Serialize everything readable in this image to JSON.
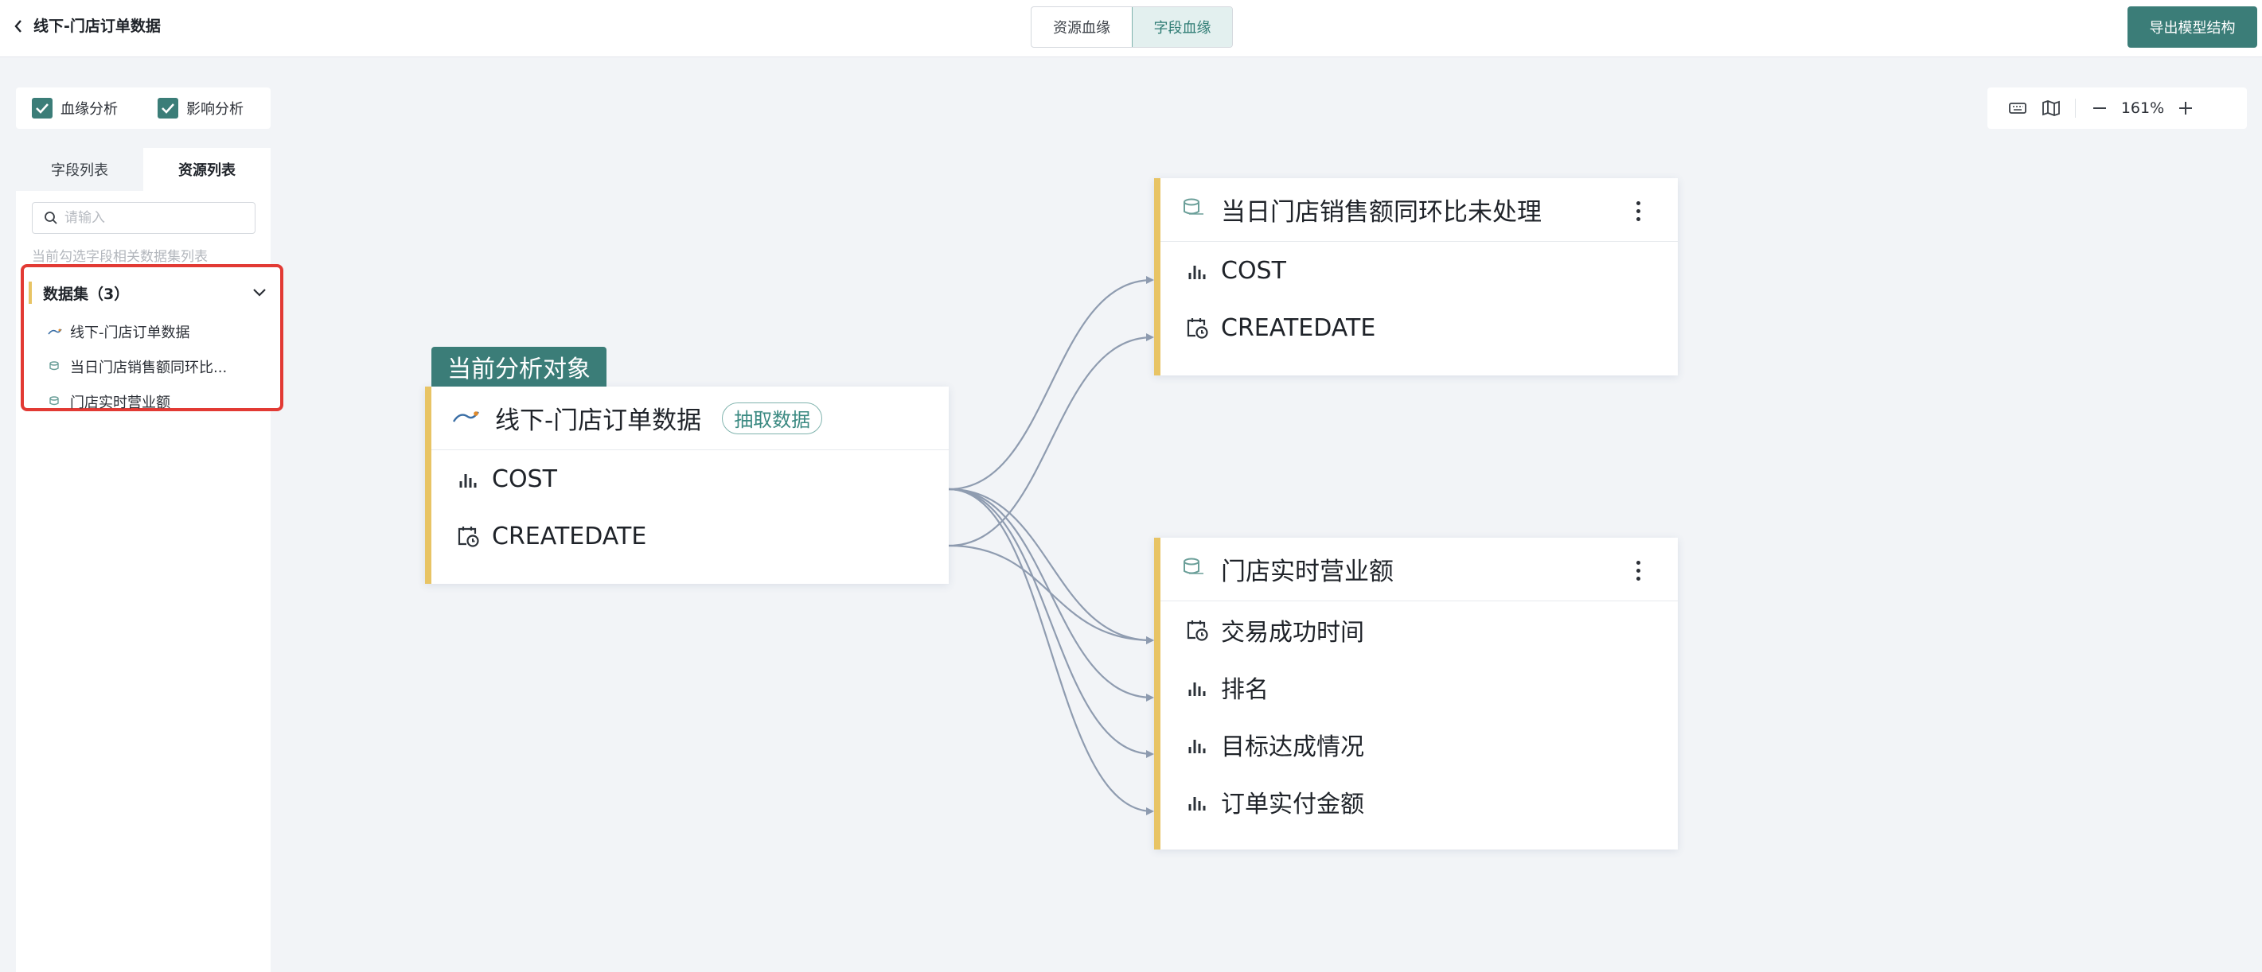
{
  "header": {
    "title": "线下-门店订单数据",
    "tabs": [
      {
        "label": "资源血缘",
        "active": false
      },
      {
        "label": "字段血缘",
        "active": true
      }
    ],
    "export_label": "导出模型结构"
  },
  "toggles": [
    {
      "label": "血缘分析",
      "checked": true
    },
    {
      "label": "影响分析",
      "checked": true
    }
  ],
  "zoom": {
    "value": "161%"
  },
  "sidebar": {
    "tabs": [
      {
        "label": "字段列表",
        "active": false
      },
      {
        "label": "资源列表",
        "active": true
      }
    ],
    "search_placeholder": "请输入",
    "hint": "当前勾选字段相关数据集列表",
    "group_title": "数据集（3）",
    "items": [
      {
        "label": "线下-门店订单数据",
        "icon": "mysql-icon"
      },
      {
        "label": "当日门店销售额同环比...",
        "icon": "etl-icon"
      },
      {
        "label": "门店实时营业额",
        "icon": "etl-icon"
      }
    ]
  },
  "canvas": {
    "current_tag": "当前分析对象",
    "source": {
      "title": "线下-门店订单数据",
      "badge": "抽取数据",
      "icon": "mysql-icon",
      "fields": [
        {
          "name": "COST",
          "type": "measure"
        },
        {
          "name": "CREATEDATE",
          "type": "date"
        }
      ]
    },
    "targets": [
      {
        "title": "当日门店销售额同环比未处理",
        "icon": "etl-icon",
        "fields": [
          {
            "name": "COST",
            "type": "measure"
          },
          {
            "name": "CREATEDATE",
            "type": "date"
          }
        ]
      },
      {
        "title": "门店实时营业额",
        "icon": "etl-icon",
        "fields": [
          {
            "name": "交易成功时间",
            "type": "date"
          },
          {
            "name": "排名",
            "type": "measure"
          },
          {
            "name": "目标达成情况",
            "type": "measure"
          },
          {
            "name": "订单实付金额",
            "type": "measure"
          }
        ]
      }
    ]
  },
  "colors": {
    "accent": "#3b7d78",
    "card_stripe": "#e8c465",
    "highlight_box": "#e23a34",
    "edge": "#8f9cb0"
  }
}
